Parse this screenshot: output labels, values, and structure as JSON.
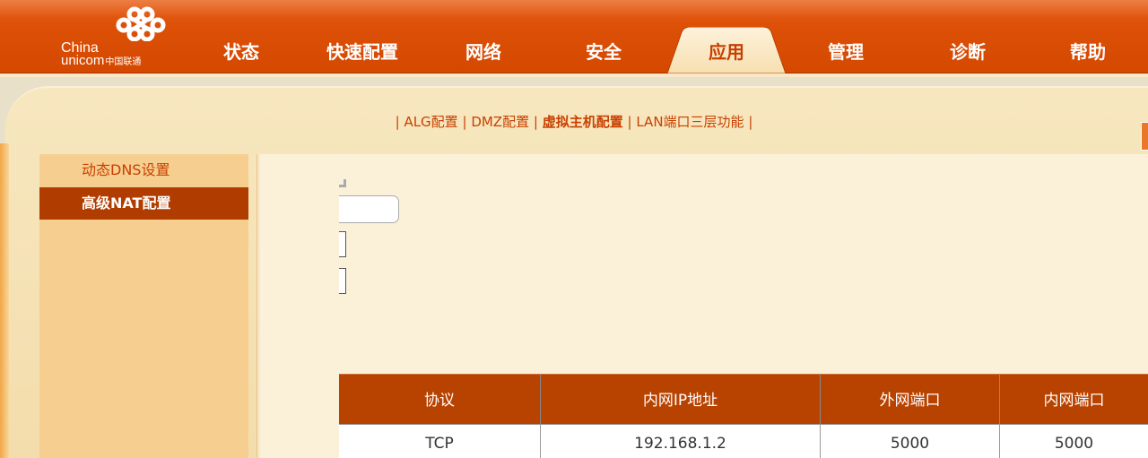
{
  "brand": {
    "china": "China",
    "unicom": "unicom",
    "unicom_cn": "中国联通",
    "logo_icon": "unicom-knot-icon"
  },
  "nav": {
    "items": [
      "状态",
      "快速配置",
      "网络",
      "安全",
      "应用",
      "管理",
      "诊断",
      "帮助"
    ],
    "active_index": 4
  },
  "subnav": {
    "items": [
      "ALG配置",
      "DMZ配置",
      "虚拟主机配置",
      "LAN端口三层功能"
    ],
    "active_index": 2,
    "separator": "|"
  },
  "leftmenu": {
    "items": [
      "动态DNS设置",
      "高级NAT配置"
    ],
    "active_index": 1
  },
  "table": {
    "headers": [
      "协议",
      "内网IP地址",
      "外网端口",
      "内网端口"
    ],
    "rows": [
      [
        "TCP",
        "192.168.1.2",
        "5000",
        "5000"
      ]
    ]
  },
  "colors": {
    "header_orange": "#dd5008",
    "accent_text": "#c84000",
    "active_menu": "#b03c00",
    "table_header": "#b84200",
    "panel_bg": "#f7e7bf"
  }
}
